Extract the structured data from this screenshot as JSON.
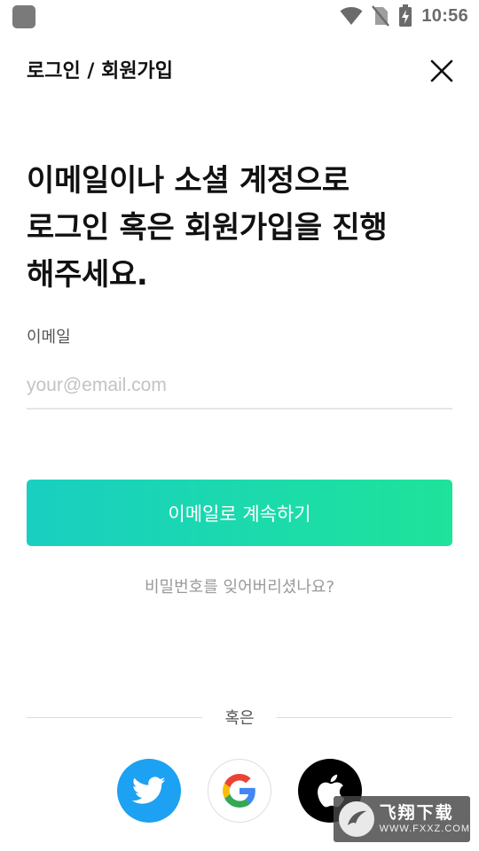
{
  "status_bar": {
    "time": "10:56",
    "icons": [
      "app-icon",
      "wifi-icon",
      "no-sim-icon",
      "battery-charging-icon"
    ]
  },
  "header": {
    "title": "로그인 / 회원가입",
    "close_icon": "close-icon"
  },
  "headline": "이메일이나 소셜 계정으로\n로그인 혹은 회원가입을 진행\n해주세요.",
  "email": {
    "label": "이메일",
    "value": "",
    "placeholder": "your@email.com"
  },
  "continue_button": {
    "label": "이메일로 계속하기"
  },
  "forgot_password": "비밀번호를 잊어버리셨나요?",
  "divider_text": "혹은",
  "social": [
    {
      "name": "twitter",
      "icon": "twitter-icon",
      "color": "#1da1f2"
    },
    {
      "name": "google",
      "icon": "google-icon",
      "color": "#ffffff"
    },
    {
      "name": "apple",
      "icon": "apple-icon",
      "color": "#000000"
    }
  ],
  "watermark": {
    "title": "飞翔下载",
    "url": "WWW.FXXZ.COM"
  },
  "colors": {
    "accent_start": "#19cfc1",
    "accent_end": "#1ee39a",
    "text_primary": "#111111",
    "placeholder": "#c3c3c3"
  }
}
